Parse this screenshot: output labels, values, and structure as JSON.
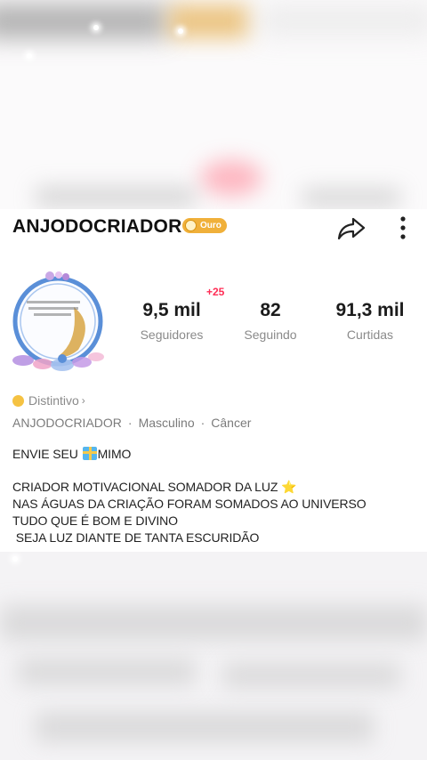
{
  "profile": {
    "username": "ANJODOCRIADOR",
    "badge_label": "Ouro",
    "avatar_text": "CRIADOR MOTIVACIONAL SOMADOR DA LUZ"
  },
  "stats": {
    "followers": {
      "value": "9,5 mil",
      "label": "Seguidores",
      "new": "+25"
    },
    "following": {
      "value": "82",
      "label": "Seguindo"
    },
    "likes": {
      "value": "91,3 mil",
      "label": "Curtidas"
    }
  },
  "distintivo": {
    "label": "Distintivo",
    "chevron": "›"
  },
  "meta": {
    "name": "ANJODOCRIADOR",
    "gender": "Masculino",
    "sign": "Câncer",
    "separator": "·"
  },
  "bio": {
    "line1_before": "ENVIE SEU ",
    "line1_after": "MIMO",
    "line2": "CRIADOR MOTIVACIONAL SOMADOR DA LUZ ⭐",
    "line3": "NAS ÁGUAS DA CRIAÇÃO FORAM SOMADOS AO UNIVERSO",
    "line4": "TUDO QUE É BOM E DIVINO",
    "line5": " SEJA LUZ DIANTE DE TANTA ESCURIDÃO"
  },
  "icons": {
    "share": "share-icon",
    "more": "more-vertical-icon",
    "gift": "gift-icon",
    "distintivo": "coin-icon"
  },
  "colors": {
    "badge_gold": "#f0b03a",
    "new_followers_red": "#ff2d55",
    "avatar_ring_blue": "#5a8fd8"
  }
}
